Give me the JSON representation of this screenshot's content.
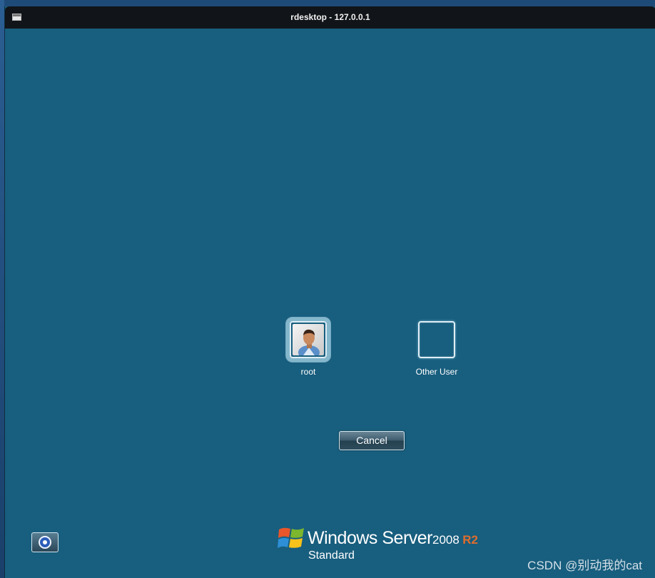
{
  "window": {
    "title": "rdesktop - 127.0.0.1"
  },
  "logon": {
    "users": [
      {
        "label": "root",
        "selected": true,
        "icon": "user-avatar-icon"
      },
      {
        "label": "Other User",
        "selected": false,
        "icon": "blank-user-tile"
      }
    ],
    "cancel_label": "Cancel",
    "ease_of_access_icon": "ease-of-access-icon"
  },
  "branding": {
    "product": "Windows Server",
    "version": "2008",
    "release": "R2",
    "edition": "Standard",
    "release_color": "#e06d2c"
  },
  "watermark": "CSDN @别动我的cat",
  "colors": {
    "background": "#185e7e",
    "titlebar": "#111418"
  }
}
